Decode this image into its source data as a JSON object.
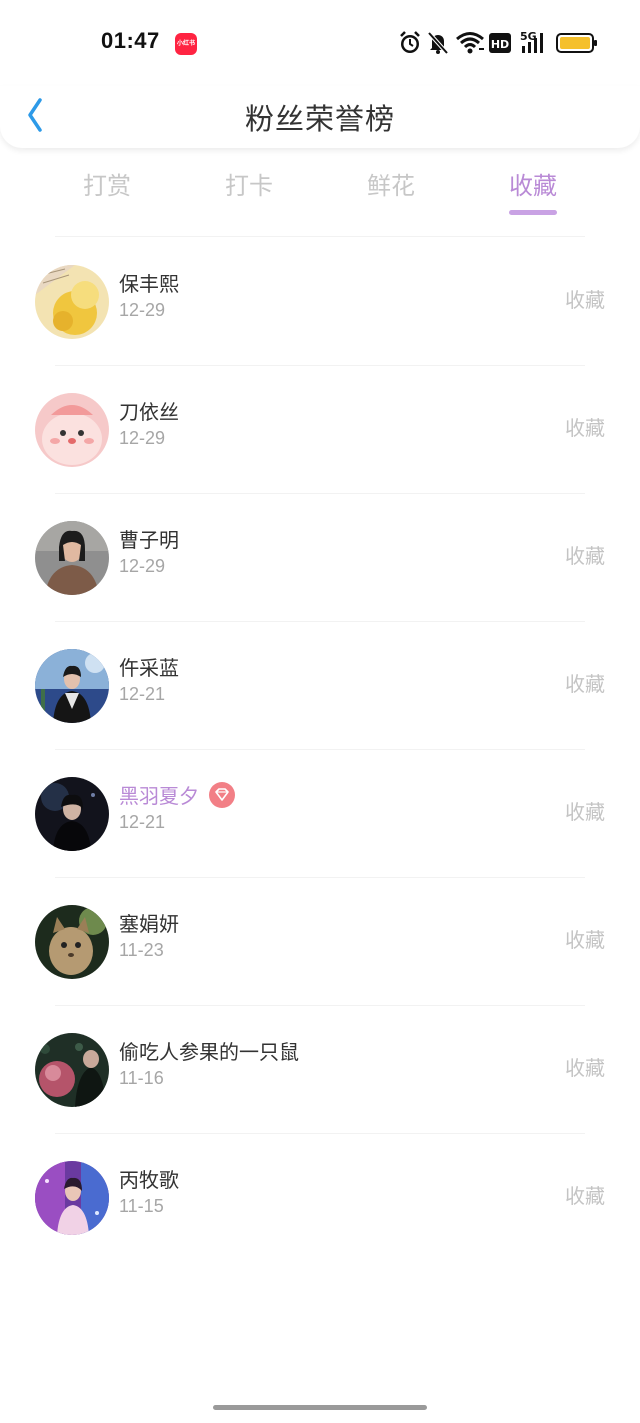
{
  "status_bar": {
    "time": "01:47",
    "app_badge": "小红书",
    "network_label": "5G",
    "hd_label": "HD",
    "icons": [
      "alarm-icon",
      "silent-bell-icon",
      "wifi-icon",
      "hd-icon",
      "signal-icon",
      "battery-icon"
    ],
    "battery_color": "#f5c02c"
  },
  "header": {
    "title": "粉丝荣誉榜",
    "back_icon": "chevron-left-icon"
  },
  "tabs": [
    {
      "label": "打赏",
      "active": false
    },
    {
      "label": "打卡",
      "active": false
    },
    {
      "label": "鲜花",
      "active": false
    },
    {
      "label": "收藏",
      "active": true
    }
  ],
  "accent_color": "#b98ad6",
  "fans": [
    {
      "name": "保丰熙",
      "date": "12-29",
      "action": "收藏"
    },
    {
      "name": "刀依丝",
      "date": "12-29",
      "action": "收藏"
    },
    {
      "name": "曹子明",
      "date": "12-29",
      "action": "收藏"
    },
    {
      "name": "仵采蓝",
      "date": "12-21",
      "action": "收藏"
    },
    {
      "name": "黑羽夏夕",
      "date": "12-21",
      "action": "收藏",
      "vip": true,
      "badge_icon": "diamond-icon"
    },
    {
      "name": "塞娟妍",
      "date": "11-23",
      "action": "收藏"
    },
    {
      "name": "偷吃人参果的一只鼠",
      "date": "11-16",
      "action": "收藏"
    },
    {
      "name": "丙牧歌",
      "date": "11-15",
      "action": "收藏"
    }
  ]
}
